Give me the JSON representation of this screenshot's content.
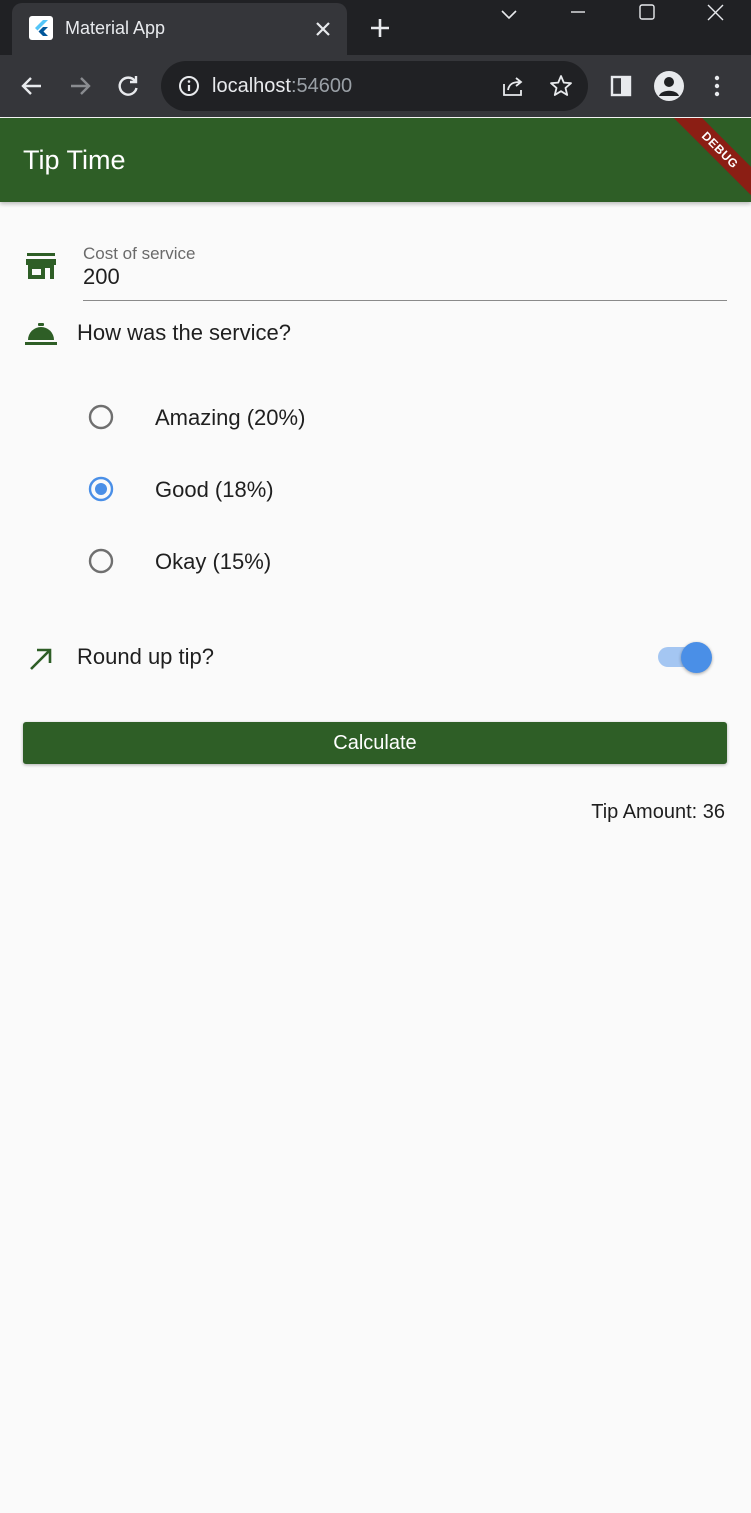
{
  "browser": {
    "tab_title": "Material App",
    "url_host": "localhost",
    "url_port": ":54600"
  },
  "app": {
    "title": "Tip Time",
    "debug_banner": "DEBUG",
    "primary_color": "#2e5e26",
    "accent_color": "#4a8fe7"
  },
  "form": {
    "cost_label": "Cost of service",
    "cost_value": "200",
    "service_question": "How was the service?",
    "options": [
      {
        "label": "Amazing (20%)",
        "selected": false
      },
      {
        "label": "Good (18%)",
        "selected": true
      },
      {
        "label": "Okay (15%)",
        "selected": false
      }
    ],
    "round_up_label": "Round up tip?",
    "round_up_enabled": true,
    "calculate_label": "Calculate",
    "tip_amount_text": "Tip Amount: 36"
  }
}
